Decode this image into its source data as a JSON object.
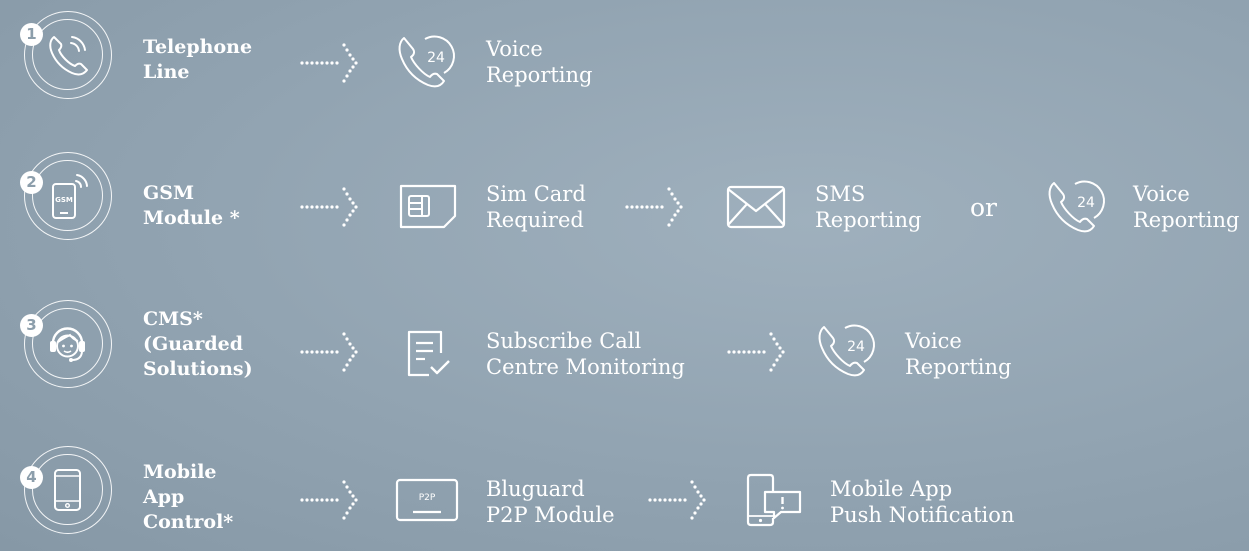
{
  "rows": [
    {
      "number": "1",
      "icon": "phone-signal-icon",
      "label": [
        "Telephone",
        "Line"
      ],
      "steps": [
        {
          "icon": "phone-24-icon",
          "text": [
            "Voice",
            "Reporting"
          ]
        }
      ]
    },
    {
      "number": "2",
      "icon": "gsm-phone-icon",
      "icon_text": "GSM",
      "label": [
        "GSM",
        "Module *"
      ],
      "steps": [
        {
          "icon": "sim-card-icon",
          "text": [
            "Sim Card",
            "Required"
          ]
        },
        {
          "icon": "envelope-icon",
          "text": [
            "SMS",
            "Reporting"
          ]
        },
        {
          "icon": "phone-24-icon",
          "text": [
            "Voice",
            "Reporting"
          ]
        }
      ],
      "connector": "or"
    },
    {
      "number": "3",
      "icon": "headset-agent-icon",
      "label": [
        "CMS*",
        "(Guarded",
        "Solutions)"
      ],
      "steps": [
        {
          "icon": "document-check-icon",
          "text": [
            "Subscribe Call",
            "Centre Monitoring"
          ]
        },
        {
          "icon": "phone-24-icon",
          "text": [
            "Voice",
            "Reporting"
          ]
        }
      ]
    },
    {
      "number": "4",
      "icon": "mobile-phone-icon",
      "label": [
        "Mobile",
        "App",
        "Control*"
      ],
      "steps": [
        {
          "icon": "p2p-module-icon",
          "icon_text": "P2P",
          "text": [
            "Bluguard",
            "P2P Module"
          ]
        },
        {
          "icon": "mobile-alert-icon",
          "text": [
            "Mobile App",
            "Push Notification"
          ]
        }
      ]
    }
  ],
  "phone_icon_text": "24",
  "colors": {
    "foreground": "#ffffff",
    "background": "#94a6b4"
  }
}
